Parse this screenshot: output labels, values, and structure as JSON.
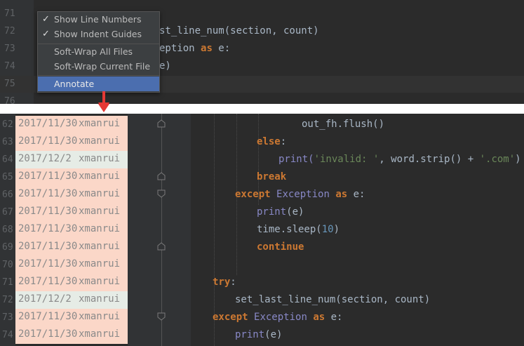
{
  "colors": {
    "editor_bg": "#2b2b2b",
    "gutter_bg": "#313335",
    "menu_bg": "#3c3f41",
    "menu_selected": "#4b6eaf",
    "annotation_bg": "#fbd7c8",
    "annotation_alt_bg": "#e6ece6",
    "keyword": "#cc7832",
    "string": "#6a8759",
    "builtin": "#8888c6",
    "arrow": "#e53935"
  },
  "top_editor": {
    "line_numbers": [
      "71",
      "72",
      "73",
      "74",
      "75",
      "76"
    ],
    "code": {
      "l72": "st_line_num(section, count)",
      "l73_a": "eption ",
      "l73_kw": "as",
      "l73_b": " e:",
      "l74": "e)"
    }
  },
  "context_menu": {
    "items": [
      {
        "label": "Show Line Numbers",
        "check": "✓"
      },
      {
        "label": "Show Indent Guides",
        "check": "✓"
      },
      {
        "label": "Soft-Wrap All Files"
      },
      {
        "label": "Soft-Wrap Current File"
      },
      {
        "label": "Annotate"
      }
    ]
  },
  "bottom_editor": {
    "annotations": [
      {
        "line": "62",
        "date": "2017/11/30",
        "author": "xmanrui"
      },
      {
        "line": "63",
        "date": "2017/11/30",
        "author": "xmanrui"
      },
      {
        "line": "64",
        "date": "2017/12/2",
        "author": "xmanrui"
      },
      {
        "line": "65",
        "date": "2017/11/30",
        "author": "xmanrui"
      },
      {
        "line": "66",
        "date": "2017/11/30",
        "author": "xmanrui"
      },
      {
        "line": "67",
        "date": "2017/11/30",
        "author": "xmanrui"
      },
      {
        "line": "68",
        "date": "2017/11/30",
        "author": "xmanrui"
      },
      {
        "line": "69",
        "date": "2017/11/30",
        "author": "xmanrui"
      },
      {
        "line": "70",
        "date": "2017/11/30",
        "author": "xmanrui"
      },
      {
        "line": "71",
        "date": "2017/11/30",
        "author": "xmanrui"
      },
      {
        "line": "72",
        "date": "2017/12/2",
        "author": "xmanrui"
      },
      {
        "line": "73",
        "date": "2017/11/30",
        "author": "xmanrui"
      },
      {
        "line": "74",
        "date": "2017/11/30",
        "author": "xmanrui"
      }
    ],
    "code": {
      "l62": "out_fh.flush()",
      "l63_kw": "else",
      "l63_punct": ":",
      "l64_a": "print(",
      "l64_str1": "'invalid: '",
      "l64_b": ", word.strip() + ",
      "l64_str2": "'.com'",
      "l64_c": ")",
      "l65_kw": "break",
      "l66_kw1": "except ",
      "l66_cls": "Exception ",
      "l66_kw2": "as",
      "l66_b": " e:",
      "l67_fn": "print",
      "l67_b": "(e)",
      "l68_a": "time.sleep(",
      "l68_num": "10",
      "l68_b": ")",
      "l69_kw": "continue",
      "l71_kw": "try",
      "l71_b": ":",
      "l72": "set_last_line_num(section, count)",
      "l73_kw1": "except ",
      "l73_cls": "Exception ",
      "l73_kw2": "as",
      "l73_b": " e:",
      "l74_fn": "print",
      "l74_b": "(e)"
    }
  }
}
